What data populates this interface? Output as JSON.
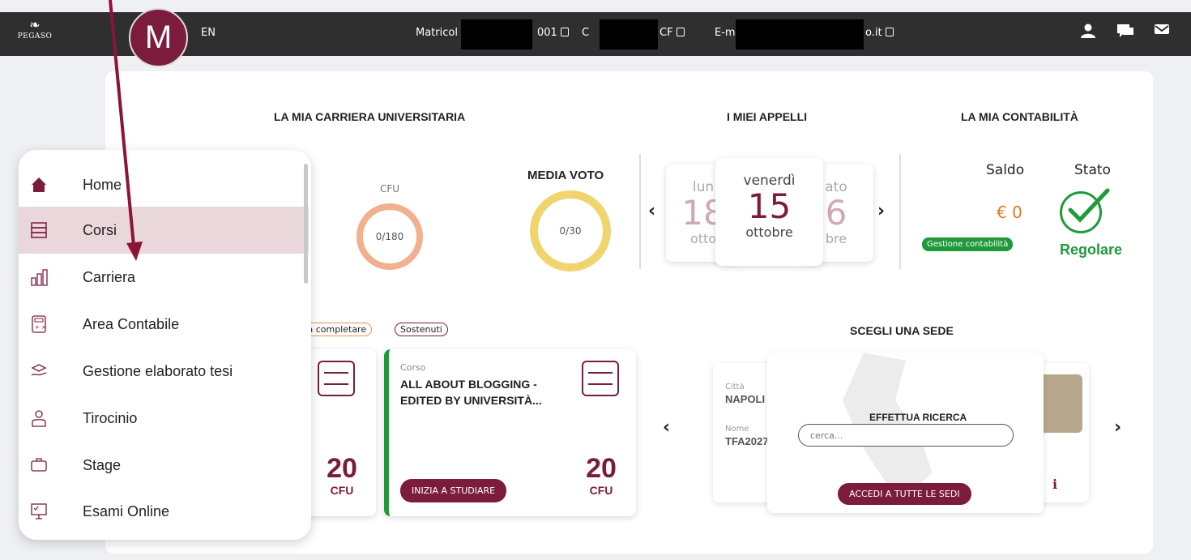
{
  "header": {
    "logo_text": "PEGASO",
    "avatar_letter": "M",
    "lang": "EN",
    "matricola_label": "Matricol",
    "matricola_suffix": "001",
    "cf_prefix": "C",
    "cf_suffix": "CF",
    "email_prefix": "E-m",
    "email_suffix": "o.it"
  },
  "icons": {
    "user": "user-icon",
    "chat": "chat-icon",
    "mail": "mail-icon"
  },
  "sections": {
    "carriera": "LA MIA CARRIERA UNIVERSITARIA",
    "appelli": "I MIEI APPELLI",
    "contabilita": "LA MIA CONTABILITÀ",
    "sede": "SCEGLI UNA SEDE"
  },
  "carriera": {
    "cfu_label": "CFU",
    "cfu_value": "0/180",
    "media_label": "MEDIA VOTO",
    "media_value": "0/30"
  },
  "appelli": {
    "prev": "‹",
    "next": "›",
    "left": {
      "day": "lun",
      "num": "18",
      "month": "otto"
    },
    "center": {
      "day": "venerdì",
      "num": "15",
      "month": "ottobre"
    },
    "right": {
      "day": "ato",
      "num": "6",
      "month": "bre"
    }
  },
  "contabilita": {
    "saldo_label": "Saldo",
    "stato_label": "Stato",
    "saldo_value": "€ 0",
    "gestione_button": "Gestione contabilità",
    "stato_value": "Regolare"
  },
  "courses": {
    "filter_da_completare": "Da completare",
    "filter_sostenuti": "Sostenuti",
    "prev": "‹",
    "card1": {
      "cfu": "20",
      "cfu_label": "CFU"
    },
    "card2": {
      "type": "Corso",
      "title_line1": "ALL ABOUT BLOGGING -",
      "title_line2": "EDITED BY UNIVERSITÀ...",
      "cfu": "20",
      "cfu_label": "CFU",
      "button": "INIZIA A STUDIARE"
    }
  },
  "sede": {
    "prev": "‹",
    "next": "›",
    "citta_label": "Città",
    "citta_value": "NAPOLI",
    "nome_label": "Nome",
    "nome_value": "TFA2027",
    "search_title": "EFFETTUA RICERCA",
    "search_placeholder": "cerca...",
    "all_button": "ACCEDI A TUTTE LE SEDI"
  },
  "sidebar": {
    "items": [
      {
        "label": "Home",
        "icon": "home-icon"
      },
      {
        "label": "Corsi",
        "icon": "books-icon"
      },
      {
        "label": "Carriera",
        "icon": "bar-chart-icon"
      },
      {
        "label": "Area Contabile",
        "icon": "calculator-icon"
      },
      {
        "label": "Gestione elaborato tesi",
        "icon": "graduation-hand-icon"
      },
      {
        "label": "Tirocinio",
        "icon": "intern-icon"
      },
      {
        "label": "Stage",
        "icon": "briefcase-icon"
      },
      {
        "label": "Esami Online",
        "icon": "monitor-exam-icon"
      }
    ],
    "active_index": 1
  },
  "colors": {
    "brand": "#7c1c3d",
    "success": "#1f9a3a",
    "orange": "#e07a1f",
    "topbar": "#2f2f2f"
  }
}
